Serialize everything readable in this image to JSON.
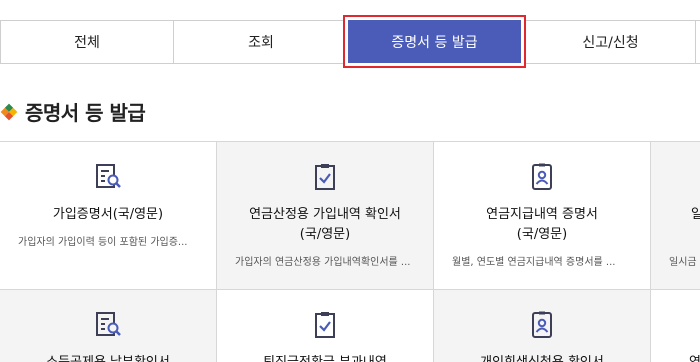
{
  "tabs": [
    {
      "label": "전체"
    },
    {
      "label": "조회"
    },
    {
      "label": "증명서 등 발급",
      "active": true
    },
    {
      "label": "신고/신청"
    }
  ],
  "section": {
    "title": "증명서 등 발급"
  },
  "cards": [
    {
      "icon": "document-search-icon",
      "title": "가입증명서(국/영문)",
      "desc": "가입자의 가입이력 등이 포함된 가입증..."
    },
    {
      "icon": "clipboard-check-icon",
      "title": "연금산정용 가입내역 확인서 (국/영문)",
      "desc": "가입자의 연금산정용 가입내역확인서를 ..."
    },
    {
      "icon": "id-badge-icon",
      "title": "연금지급내역 증명서 (국/영문)",
      "desc": "월별, 연도별 연금지급내역 증명서를 ..."
    },
    {
      "icon": "document-icon",
      "title": "일",
      "desc": "일시금"
    },
    {
      "icon": "document-search-icon",
      "title": "소득공제용 납부확인서",
      "desc": ""
    },
    {
      "icon": "clipboard-check-icon",
      "title": "퇴직금전환금 부과내역",
      "desc": ""
    },
    {
      "icon": "id-badge-icon",
      "title": "개인회생신청용 확인서",
      "desc": ""
    },
    {
      "icon": "document-icon",
      "title": "연",
      "desc": ""
    }
  ],
  "colors": {
    "active_tab": "#4a5bb8",
    "highlight_border": "#e0282e",
    "icon": "#3c3f56",
    "icon_accent": "#4a5bb8"
  }
}
